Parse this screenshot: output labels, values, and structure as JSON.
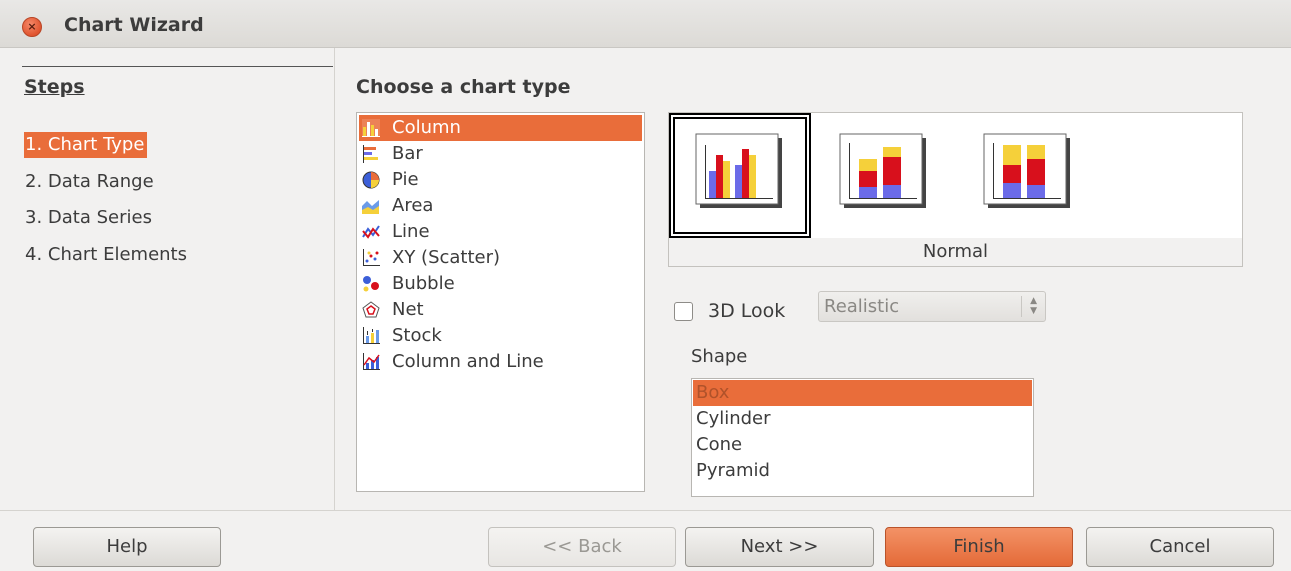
{
  "window": {
    "title": "Chart Wizard"
  },
  "steps": {
    "title": "Steps",
    "items": [
      {
        "label": "1. Chart Type",
        "active": true
      },
      {
        "label": "2. Data Range",
        "active": false
      },
      {
        "label": "3. Data Series",
        "active": false
      },
      {
        "label": "4. Chart Elements",
        "active": false
      }
    ]
  },
  "main": {
    "title": "Choose a chart type",
    "chart_types": [
      {
        "label": "Column",
        "icon": "column-chart-icon",
        "selected": true
      },
      {
        "label": "Bar",
        "icon": "bar-chart-icon",
        "selected": false
      },
      {
        "label": "Pie",
        "icon": "pie-chart-icon",
        "selected": false
      },
      {
        "label": "Area",
        "icon": "area-chart-icon",
        "selected": false
      },
      {
        "label": "Line",
        "icon": "line-chart-icon",
        "selected": false
      },
      {
        "label": "XY (Scatter)",
        "icon": "scatter-chart-icon",
        "selected": false
      },
      {
        "label": "Bubble",
        "icon": "bubble-chart-icon",
        "selected": false
      },
      {
        "label": "Net",
        "icon": "net-chart-icon",
        "selected": false
      },
      {
        "label": "Stock",
        "icon": "stock-chart-icon",
        "selected": false
      },
      {
        "label": "Column and Line",
        "icon": "column-and-line-chart-icon",
        "selected": false
      }
    ],
    "variants": [
      {
        "name": "normal-column-variant",
        "selected": true
      },
      {
        "name": "stacked-column-variant",
        "selected": false
      },
      {
        "name": "percent-stacked-column-variant",
        "selected": false
      }
    ],
    "variant_caption": "Normal",
    "look": {
      "checkbox_label": "3D Look",
      "checked": false,
      "select_value": "Realistic"
    },
    "shape": {
      "label": "Shape",
      "items": [
        {
          "label": "Box",
          "selected": true
        },
        {
          "label": "Cylinder",
          "selected": false
        },
        {
          "label": "Cone",
          "selected": false
        },
        {
          "label": "Pyramid",
          "selected": false
        }
      ]
    }
  },
  "buttons": {
    "help": "Help",
    "back": "<< Back",
    "next": "Next >>",
    "finish": "Finish",
    "cancel": "Cancel"
  },
  "colors": {
    "accent": "#e96d3a",
    "bar_blue": "#6b6be8",
    "bar_yellow": "#f5d03a",
    "bar_red": "#d8101c"
  }
}
